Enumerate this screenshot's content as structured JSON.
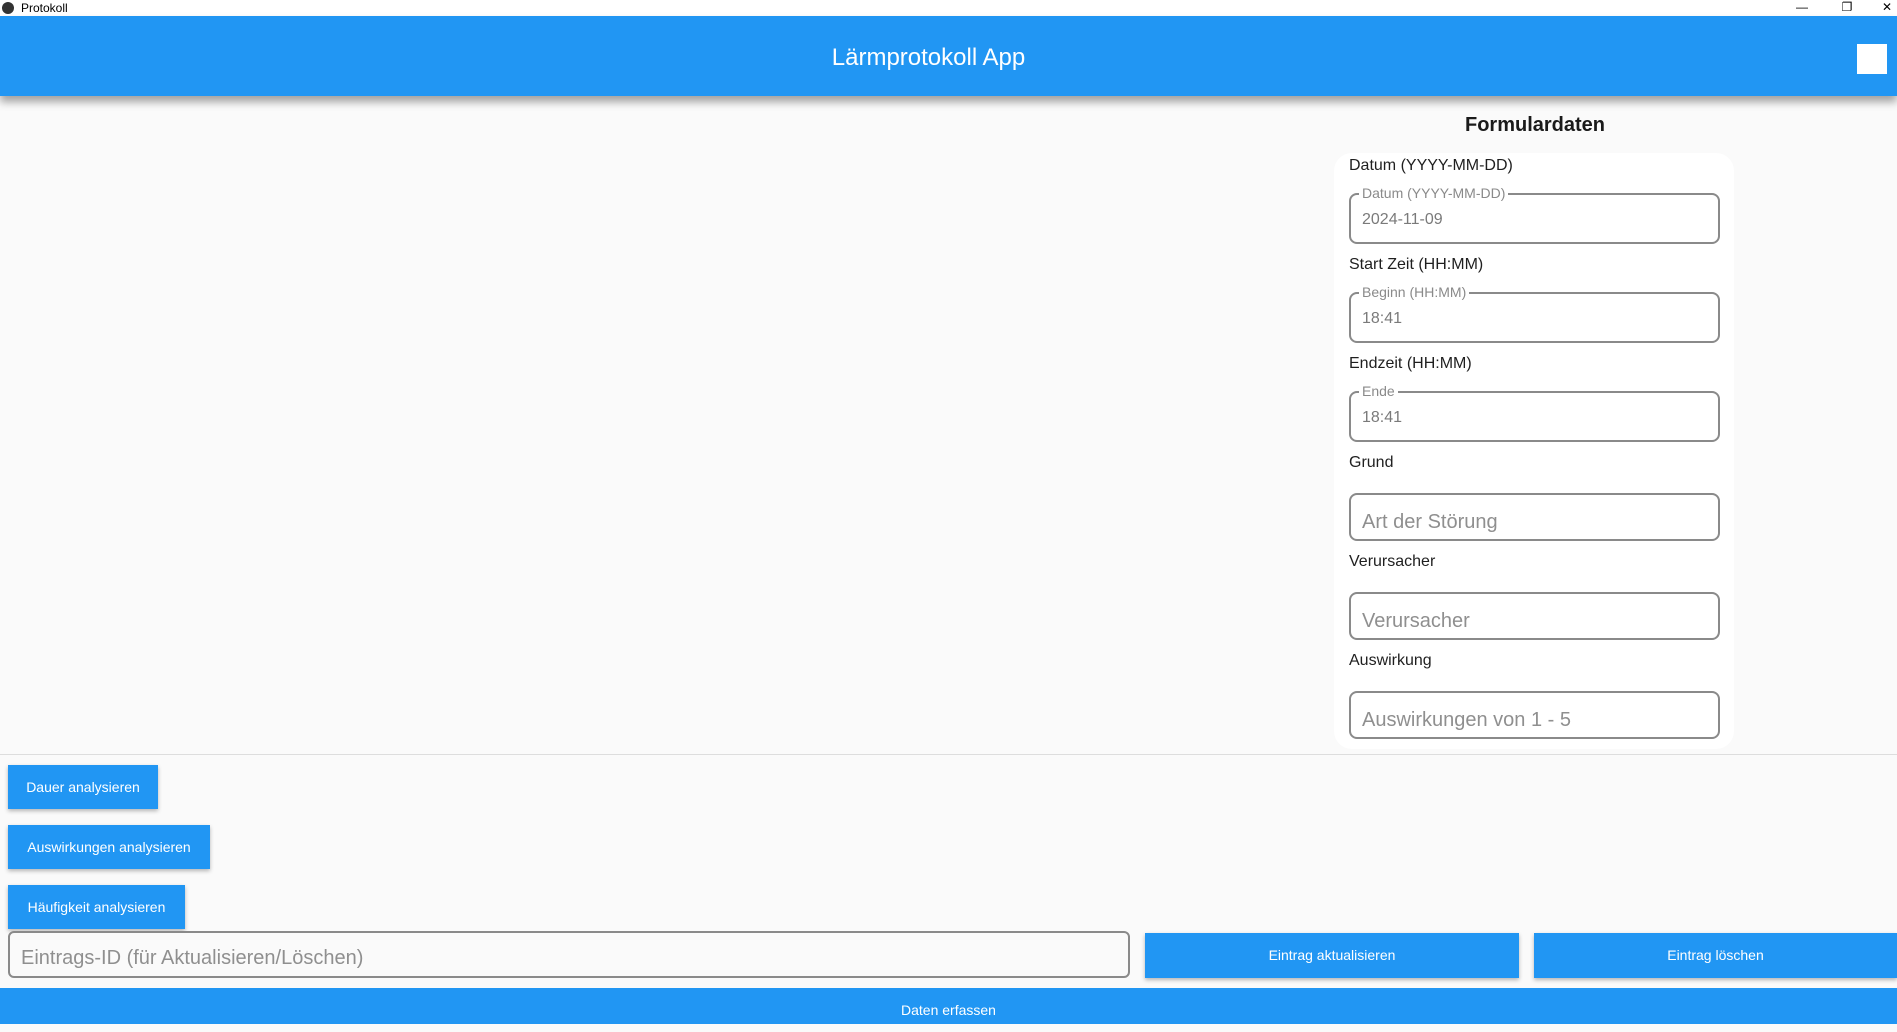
{
  "window": {
    "title": "Protokoll",
    "minimize_glyph": "—",
    "restore_glyph": "❐",
    "close_glyph": "✕"
  },
  "appbar": {
    "title": "Lärmprotokoll App"
  },
  "form": {
    "heading": "Formulardaten",
    "fields": [
      {
        "label": "Datum (YYYY-MM-DD)",
        "floating_label": "Datum (YYYY-MM-DD)",
        "value": "2024-11-09"
      },
      {
        "label": "Start Zeit (HH:MM)",
        "floating_label": "Beginn (HH:MM)",
        "value": "18:41"
      },
      {
        "label": "Endzeit (HH:MM)",
        "floating_label": "Ende",
        "value": "18:41"
      },
      {
        "label": "Grund",
        "placeholder": "Art der Störung"
      },
      {
        "label": "Verursacher",
        "placeholder": "Verursacher"
      },
      {
        "label": "Auswirkung",
        "placeholder": "Auswirkungen von 1 - 5"
      }
    ]
  },
  "analysis": {
    "duration_label": "Dauer analysieren",
    "impact_label": "Auswirkungen analysieren",
    "frequency_label": "Häufigkeit analysieren"
  },
  "entry": {
    "id_placeholder": "Eintrags-ID (für Aktualisieren/Löschen)",
    "update_label": "Eintrag aktualisieren",
    "delete_label": "Eintrag löschen"
  },
  "bottom": {
    "submit_label": "Daten erfassen"
  },
  "colors": {
    "primary": "#2196f3",
    "background": "#fafafa",
    "card": "#ffffff"
  }
}
